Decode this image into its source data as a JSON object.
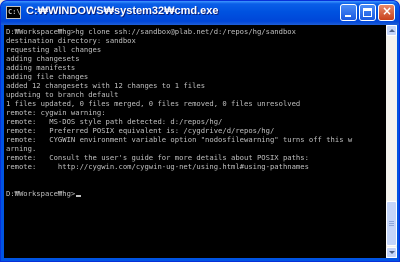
{
  "window": {
    "title": "C:\\WINDOWS\\system32\\cmd.exe",
    "title_display": "C:₩WINDOWS₩system32₩cmd.exe",
    "app_icon": "cmd-icon",
    "controls": {
      "minimize": "minimize-icon",
      "maximize": "maximize-icon",
      "close": "close-icon",
      "close_glyph": "×"
    }
  },
  "console": {
    "lines": [
      "D:₩Workspace₩hg>hg clone ssh://sandbox@plab.net/d:/repos/hg/sandbox",
      "destination directory: sandbox",
      "requesting all changes",
      "adding changesets",
      "adding manifests",
      "adding file changes",
      "added 12 changesets with 12 changes to 1 files",
      "updating to branch default",
      "1 files updated, 0 files merged, 0 files removed, 0 files unresolved",
      "remote: cygwin warning:",
      "remote:   MS-DOS style path detected: d:/repos/hg/",
      "remote:   Preferred POSIX equivalent is: /cygdrive/d/repos/hg/",
      "remote:   CYGWIN environment variable option \"nodosfilewarning\" turns off this w",
      "arning.",
      "remote:   Consult the user's guide for more details about POSIX paths:",
      "remote:     http://cygwin.com/cygwin-ug-net/using.html#using-pathnames",
      "",
      "D:₩Workspace₩hg>"
    ]
  },
  "scrollbar": {
    "position_fraction": 0.95
  },
  "colors": {
    "console_bg": "#000000",
    "console_text": "#c0c0c0",
    "titlebar_blue": "#0054e3",
    "close_red": "#c8411c"
  }
}
